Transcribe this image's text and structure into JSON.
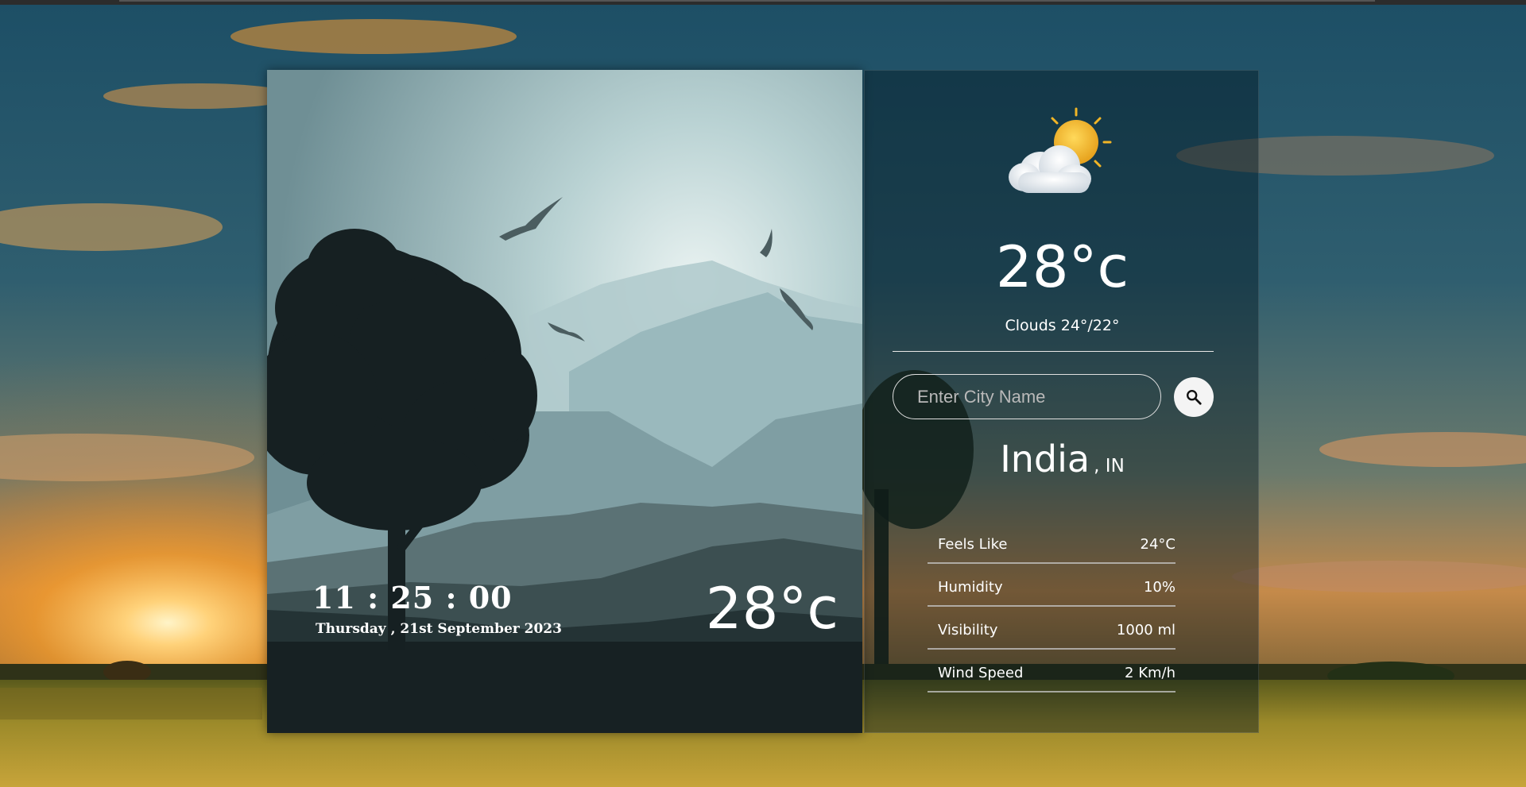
{
  "clock": {
    "time": "11 : 25 : 00",
    "date": "Thursday , 21st September 2023"
  },
  "left_temperature": "28°c",
  "current": {
    "icon": "partly-cloudy-icon",
    "temperature": "28°c",
    "condition": "Clouds 24°/22°"
  },
  "search": {
    "placeholder": "Enter City Name",
    "value": "",
    "button_icon": "search-icon"
  },
  "location": {
    "city": "India",
    "country": ", IN"
  },
  "details": [
    {
      "label": "Feels Like",
      "value": "24°C"
    },
    {
      "label": "Humidity",
      "value": "10%"
    },
    {
      "label": "Visibility",
      "value": "1000 ml"
    },
    {
      "label": "Wind Speed",
      "value": "2 Km/h"
    }
  ],
  "colors": {
    "accent_text": "#ffffff",
    "card_dark": "#14201f",
    "sky_top": "#7e9ea3"
  }
}
